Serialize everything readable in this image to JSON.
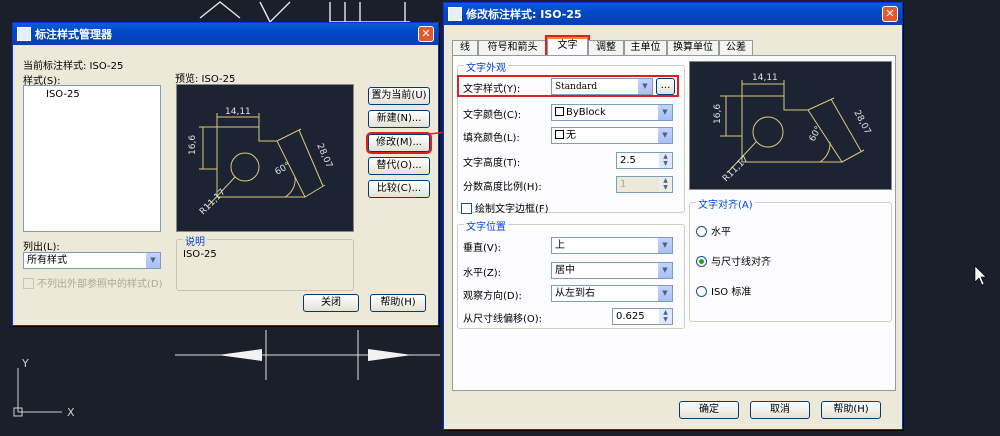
{
  "mgr": {
    "title": "标注样式管理器",
    "current_style": "当前标注样式: ISO-25",
    "styles_label": "样式(S):",
    "styles": [
      "ISO-25"
    ],
    "preview_label": "预览: ISO-25",
    "buttons": {
      "set_current": "置为当前(U)",
      "new": "新建(N)...",
      "modify": "修改(M)...",
      "override": "替代(O)...",
      "compare": "比较(C)..."
    },
    "list_label": "列出(L):",
    "list_value": "所有样式",
    "xref_checkbox": "不列出外部参照中的样式(D)",
    "desc_title": "说明",
    "desc_value": "ISO-25",
    "close_button": "关闭",
    "help_button": "帮助(H)"
  },
  "mod": {
    "title": "修改标注样式: ISO-25",
    "tabs": [
      "线",
      "符号和箭头",
      "文字",
      "调整",
      "主单位",
      "换算单位",
      "公差"
    ],
    "active_tab": "文字",
    "appearance": {
      "title": "文字外观",
      "style_label": "文字样式(Y):",
      "style_value": "Standard",
      "browse": "...",
      "color_label": "文字颜色(C):",
      "color_value": "ByBlock",
      "fill_label": "填充颜色(L):",
      "fill_value": "无",
      "height_label": "文字高度(T):",
      "height_value": "2.5",
      "fraction_label": "分数高度比例(H):",
      "fraction_value": "1",
      "frame_label": "绘制文字边框(F)"
    },
    "placement": {
      "title": "文字位置",
      "vertical_label": "垂直(V):",
      "vertical_value": "上",
      "horizontal_label": "水平(Z):",
      "horizontal_value": "居中",
      "view_label": "观察方向(D):",
      "view_value": "从左到右",
      "offset_label": "从尺寸线偏移(O):",
      "offset_value": "0.625"
    },
    "alignment": {
      "title": "文字对齐(A)",
      "options": [
        "水平",
        "与尺寸线对齐",
        "ISO 标准"
      ],
      "selected": "与尺寸线对齐"
    },
    "buttons": {
      "ok": "确定",
      "cancel": "取消",
      "help": "帮助(H)"
    }
  },
  "preview": {
    "d1": "14,11",
    "d2": "16,6",
    "d3": "28,07",
    "angle": "60°",
    "radius": "R11,17"
  },
  "cad": {
    "axis_y": "Y",
    "axis_x": "X"
  },
  "colors": {
    "accent": "#0046d5",
    "highlight": "#e02020",
    "cad_bg": "#1a1f29",
    "preview_line": "#d8c97a"
  }
}
